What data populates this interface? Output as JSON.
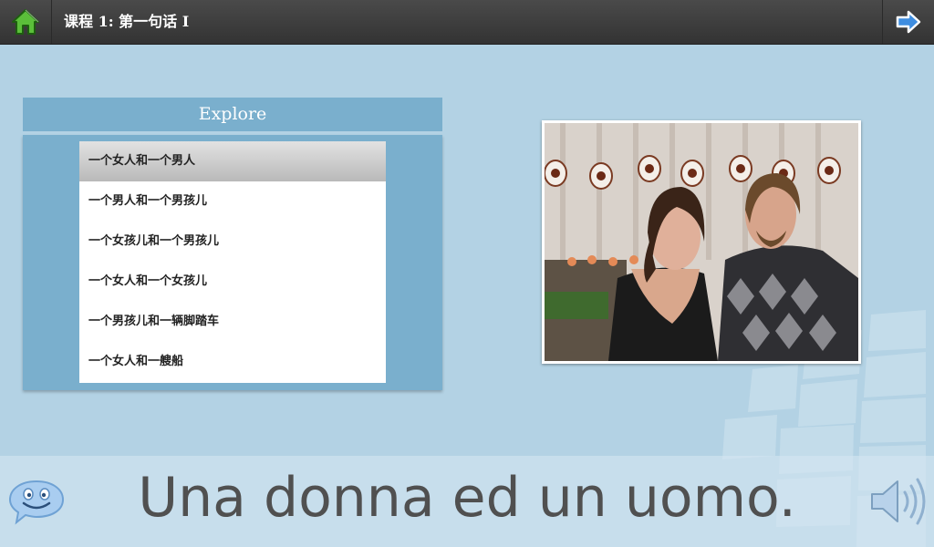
{
  "header": {
    "title": "课程 1: 第一句话 I",
    "home_icon": "home-icon",
    "next_icon": "arrow-right-icon"
  },
  "explore": {
    "title": "Explore",
    "items": [
      {
        "label": "一个女人和一个男人",
        "selected": true
      },
      {
        "label": "一个男人和一个男孩儿",
        "selected": false
      },
      {
        "label": "一个女孩儿和一个男孩儿",
        "selected": false
      },
      {
        "label": "一个女人和一个女孩儿",
        "selected": false
      },
      {
        "label": "一个男孩儿和一辆脚踏车",
        "selected": false
      },
      {
        "label": "一个女人和一艘船",
        "selected": false
      }
    ]
  },
  "footer": {
    "sentence": "Una donna ed un uomo.",
    "chat_icon": "smiley-chat-icon",
    "speaker_icon": "speaker-icon"
  },
  "colors": {
    "background": "#b3d2e4",
    "panel": "#7aafcd",
    "topbar": "#3b3b3b",
    "selected_row": "#c4c4c4"
  }
}
